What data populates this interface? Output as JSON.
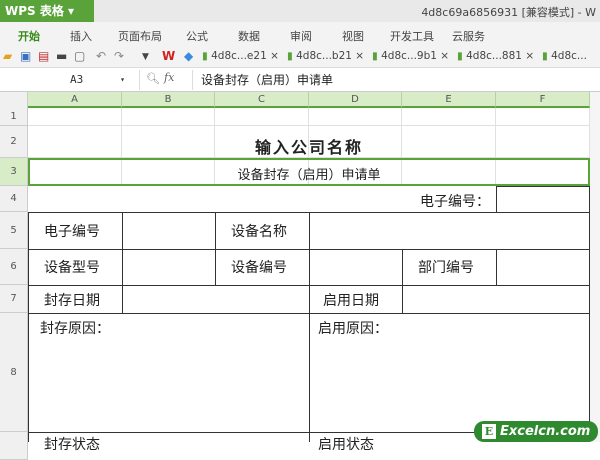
{
  "app": {
    "name": "WPS 表格",
    "title": "4d8c69a6856931 [兼容模式] - W"
  },
  "menu": [
    "开始",
    "插入",
    "页面布局",
    "公式",
    "数据",
    "审阅",
    "视图",
    "开发工具",
    "云服务"
  ],
  "doc_tabs": [
    "4d8c...e21",
    "4d8c...b21",
    "4d8c...9b1",
    "4d8c...881",
    "4d8c..."
  ],
  "formula_bar": {
    "cell_ref": "A3",
    "fx": "fx",
    "value": "设备封存（启用）申请单"
  },
  "columns": [
    "A",
    "B",
    "C",
    "D",
    "E",
    "F"
  ],
  "rows": [
    "1",
    "2",
    "3",
    "4",
    "5",
    "6",
    "7",
    "8"
  ],
  "sheet": {
    "company": "输入公司名称",
    "form_title": "设备封存（启用）申请单",
    "e_number_label": "电子编号：",
    "r5": [
      "电子编号",
      "设备名称"
    ],
    "r6": [
      "设备型号",
      "设备编号",
      "部门编号"
    ],
    "r7": [
      "封存日期",
      "启用日期"
    ],
    "r8": [
      "封存原因：",
      "启用原因："
    ],
    "r9": [
      "封存状态",
      "启用状态"
    ]
  },
  "watermark": "Excelcn.com",
  "colors": {
    "brand": "#5aa33a"
  }
}
